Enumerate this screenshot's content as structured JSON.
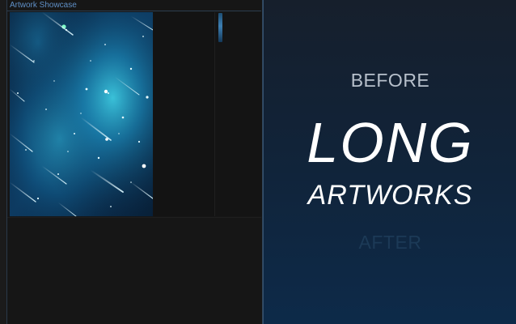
{
  "window": {
    "title": "Artwork Showcase"
  },
  "artwork": {
    "main_image_icon": "galaxy-starfield-artwork",
    "thumbnail_icon": "artwork-thumbnail-sliver"
  },
  "promo": {
    "before_label": "BEFORE",
    "headline": "LONG",
    "subheadline": "ARTWORKS",
    "after_label": "AFTER"
  },
  "colors": {
    "title_text": "#5f8fc6",
    "panel_dark": "#1b1b1b",
    "promo_gradient_top": "#161f2c",
    "promo_gradient_bottom": "#0d2a49",
    "headline_text": "#ffffff",
    "before_text": "#b7c0cb",
    "after_text_faded": "#1c3a57"
  }
}
